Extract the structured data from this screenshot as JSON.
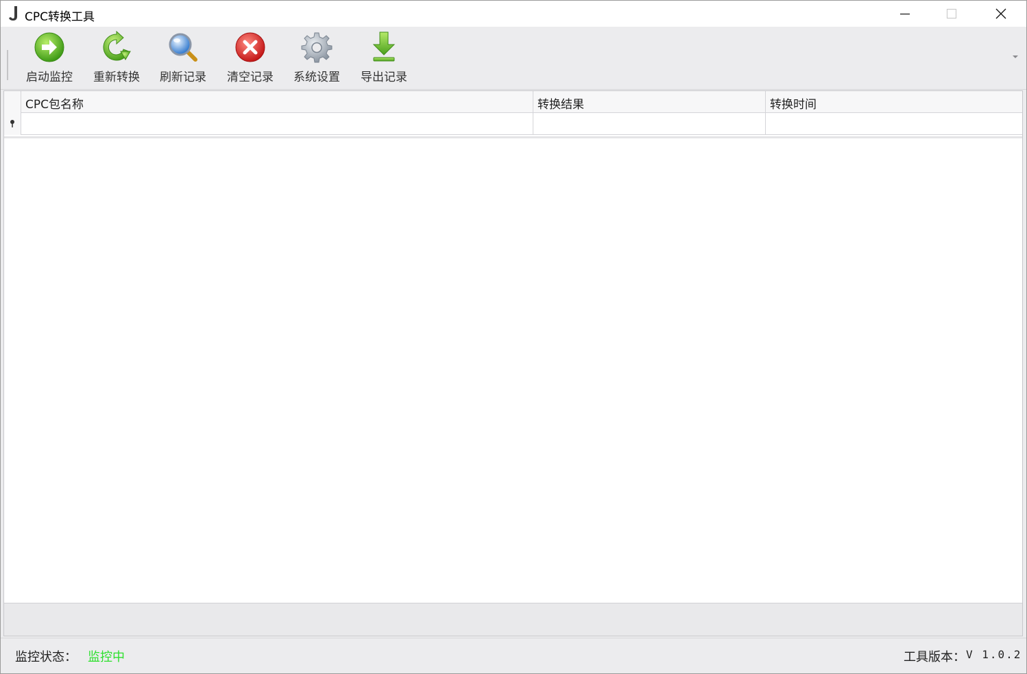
{
  "window": {
    "title": "CPC转换工具",
    "controls": [
      "minimize-icon",
      "maximize-icon",
      "close-icon"
    ]
  },
  "toolbar": {
    "items": [
      {
        "label": "启动监控",
        "icon": "play-arrow-icon",
        "color": "#5fb526"
      },
      {
        "label": "重新转换",
        "icon": "refresh-icon",
        "color": "#6cbb2a"
      },
      {
        "label": "刷新记录",
        "icon": "magnifier-icon",
        "color": "#3a86d8"
      },
      {
        "label": "清空记录",
        "icon": "clear-x-icon",
        "color": "#d92b2b"
      },
      {
        "label": "系统设置",
        "icon": "gear-icon",
        "color": "#9aa3ad"
      },
      {
        "label": "导出记录",
        "icon": "download-icon",
        "color": "#6cbb2a"
      }
    ]
  },
  "grid": {
    "columns": [
      "CPC包名称",
      "转换结果",
      "转换时间"
    ],
    "filter_row_icon": "pin-icon",
    "rows": []
  },
  "status": {
    "monitor_label": "监控状态：",
    "monitor_value": "监控中",
    "monitor_value_color": "#2ee02e",
    "version_label": "工具版本：",
    "version_value": "V 1.0.2"
  }
}
